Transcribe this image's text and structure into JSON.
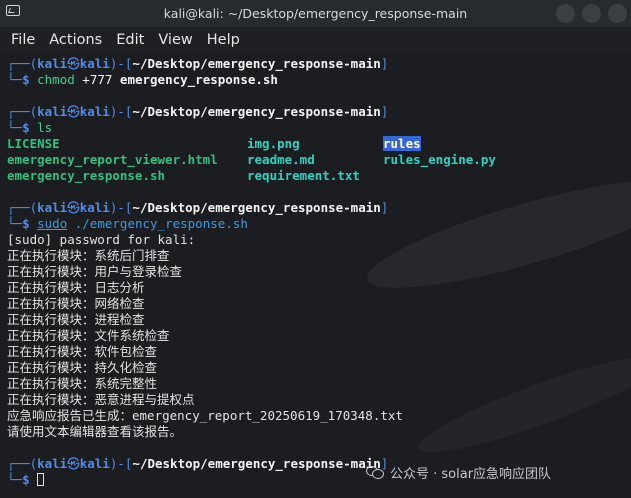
{
  "window": {
    "title": "kali@kali: ~/Desktop/emergency_response-main"
  },
  "menu": [
    "File",
    "Actions",
    "Edit",
    "View",
    "Help"
  ],
  "prompt": {
    "user_host_left": "┌──(",
    "user": "kali",
    "at": "㉿",
    "host": "kali",
    "mid": ")-[",
    "path": "~/Desktop/emergency_response-main",
    "end": "]",
    "corner": "└─",
    "dollar": "$"
  },
  "commands": {
    "c1_bin": "chmod",
    "c1_args": " +777 ",
    "c1_file": "emergency_response.sh",
    "c2": "ls",
    "c3_sudo": "sudo",
    "c3_args": " ./emergency_response.sh"
  },
  "ls": {
    "col1": [
      "LICENSE",
      "emergency_report_viewer.html",
      "emergency_response.sh"
    ],
    "col2": [
      "img.png",
      "readme.md",
      "requirement.txt"
    ],
    "col3": [
      "rules",
      "rules_engine.py"
    ]
  },
  "output": [
    "[sudo] password for kali:",
    "正在执行模块：系统后门排查",
    "正在执行模块：用户与登录检查",
    "正在执行模块：日志分析",
    "正在执行模块：网络检查",
    "正在执行模块：进程检查",
    "正在执行模块：文件系统检查",
    "正在执行模块：软件包检查",
    "正在执行模块：持久化检查",
    "正在执行模块：系统完整性",
    "正在执行模块：恶意进程与提权点",
    "应急响应报告已生成：emergency_report_20250619_170348.txt",
    "请使用文本编辑器查看该报告。"
  ],
  "watermark": {
    "text": "公众号 · solar应急响应团队"
  }
}
